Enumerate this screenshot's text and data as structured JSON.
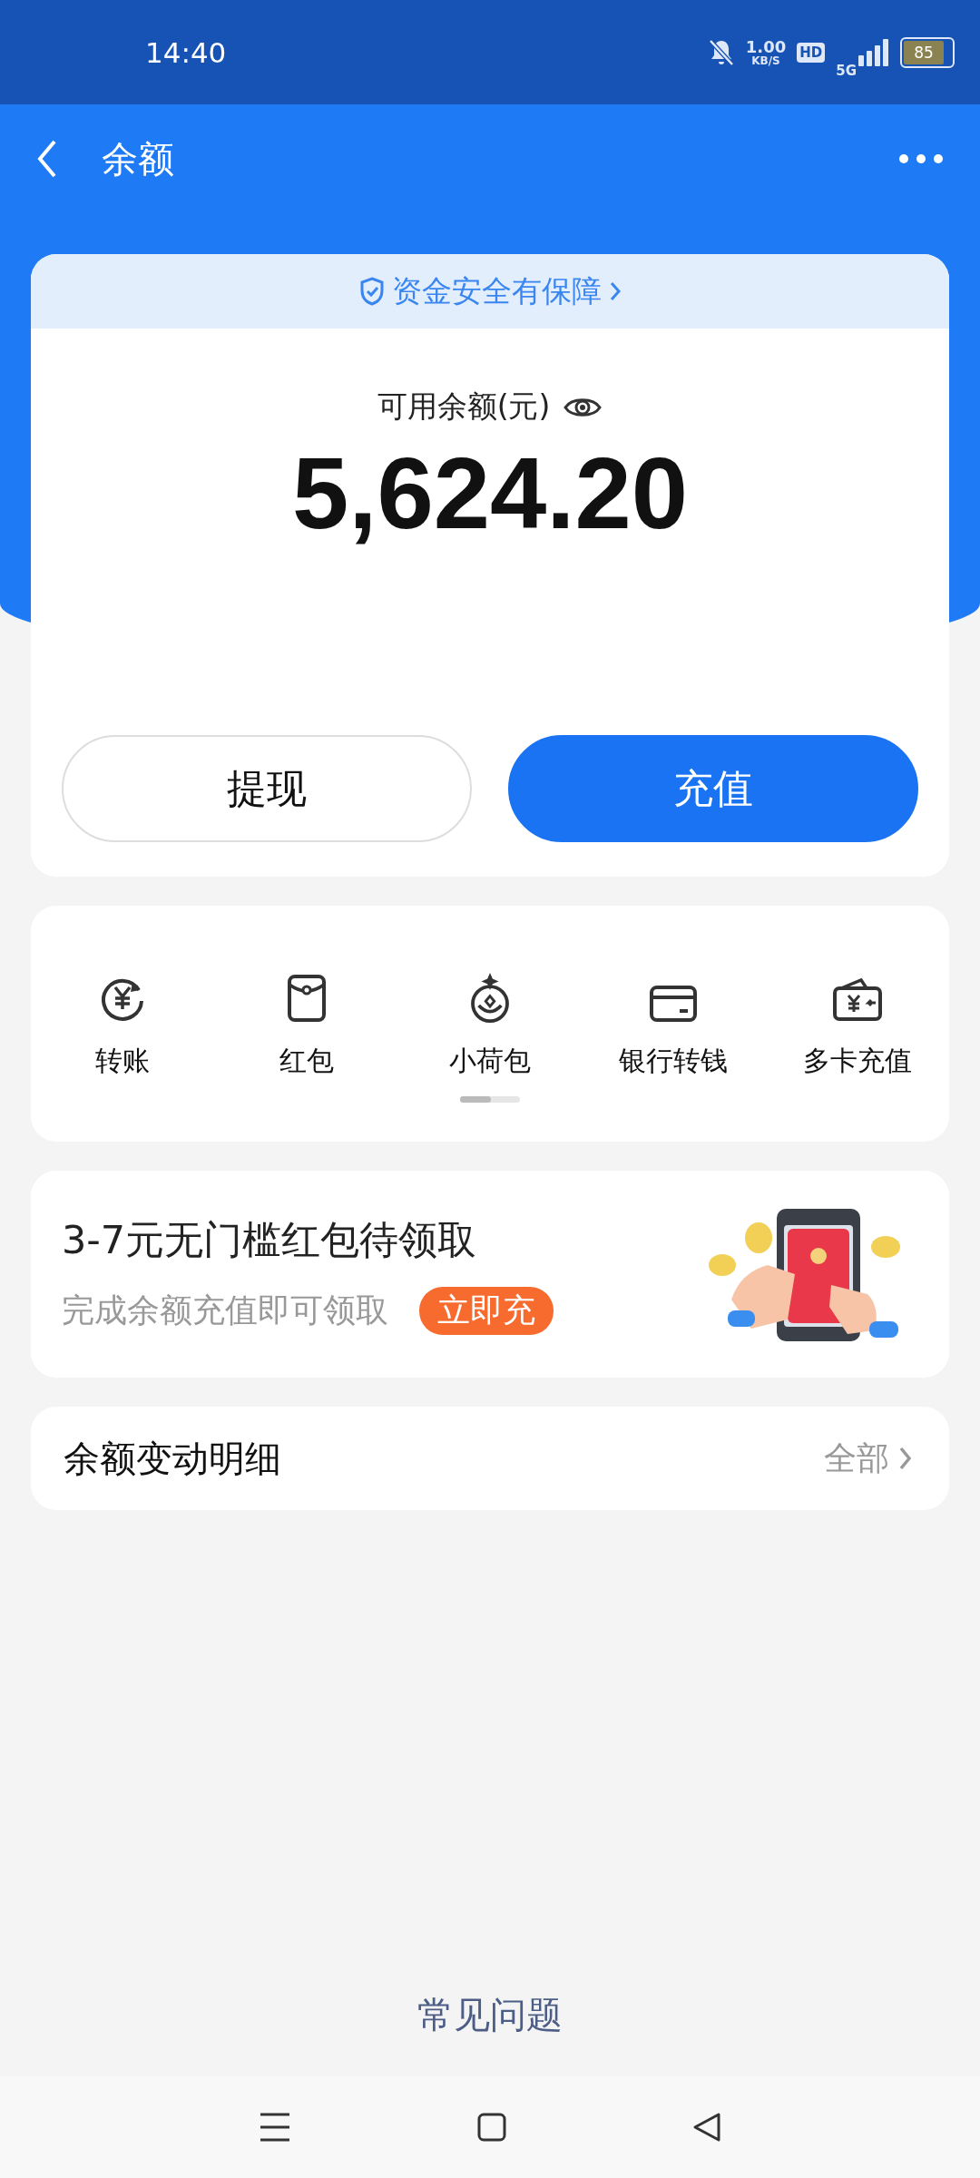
{
  "status_bar": {
    "time": "14:40",
    "speed": "1.00",
    "speed_unit": "KB/S",
    "hd": "HD",
    "network": "5G",
    "battery": "85"
  },
  "header": {
    "title": "余额"
  },
  "balance_card": {
    "notice": "资金安全有保障",
    "label": "可用余额(元)",
    "amount": "5,624.20",
    "buttons": [
      {
        "label": "提现",
        "primary": false
      },
      {
        "label": "充值",
        "primary": true
      }
    ]
  },
  "services": [
    {
      "label": "转账"
    },
    {
      "label": "红包"
    },
    {
      "label": "小荷包"
    },
    {
      "label": "银行转钱"
    },
    {
      "label": "多卡充值"
    }
  ],
  "promo": {
    "title": "3-7元无门槛红包待领取",
    "subtitle": "完成余额充值即可领取",
    "action": "立即充"
  },
  "details": {
    "title": "余额变动明细",
    "link": "全部"
  },
  "faq": "常见问题"
}
